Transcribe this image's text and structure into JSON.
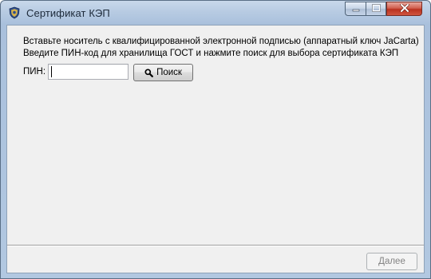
{
  "window": {
    "title": "Сертификат КЭП",
    "app_icon": "shield-emblem-icon",
    "controls": [
      "minimize-icon",
      "maximize-icon",
      "close-icon"
    ]
  },
  "content": {
    "instruction_line1": "Вставьте носитель с квалифицированной электронной подписью (аппаратный ключ JaCarta)",
    "instruction_line2": "Введите ПИН-код для хранилища ГОСТ и нажмите поиск для выбора сертификата КЭП",
    "pin_label": "ПИН:",
    "pin_value": "",
    "search_label": "Поиск",
    "search_icon": "magnifier-icon"
  },
  "footer": {
    "next_label": "Далее",
    "next_enabled": false
  },
  "colors": {
    "titlebar": "#b7cbe2",
    "client_bg": "#f0f0f0",
    "close_button": "#c9432f",
    "disabled_text": "#838383"
  }
}
